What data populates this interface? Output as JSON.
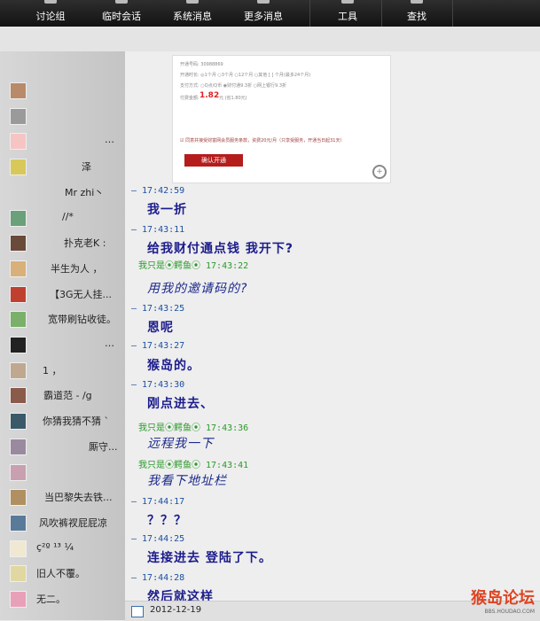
{
  "toolbar": {
    "items": [
      "讨论组",
      "临时会话",
      "系统消息",
      "更多消息",
      "工具",
      "查找"
    ]
  },
  "sidebar": {
    "items": [
      {
        "name": "",
        "av": "#b88a6a"
      },
      {
        "name": "",
        "av": "#9a9a9a"
      },
      {
        "name": "…",
        "av": "#f7c4c4"
      },
      {
        "name": "泽",
        "av": "#d8c85a"
      },
      {
        "name": "Mr  zhi丶",
        "av": ""
      },
      {
        "name": "//*",
        "av": "#6aa07a"
      },
      {
        "name": "扑克老K :",
        "av": "#6a4a3a"
      },
      {
        "name": "半生为人   ，",
        "av": "#d8b07a"
      },
      {
        "name": "【3G无人挂...",
        "av": "#c04030"
      },
      {
        "name": "宽带刷钻收徒。",
        "av": "#7ab06a"
      },
      {
        "name": "…",
        "av": "#222222"
      },
      {
        "name": "1 ，",
        "av": "#c0a890"
      },
      {
        "name": "霸道范 - /g",
        "av": "#8a5a4a"
      },
      {
        "name": "你猜我猜不猜 `",
        "av": "#3a5a6a"
      },
      {
        "name": "厮守...",
        "av": "#9a8aa0"
      },
      {
        "name": "",
        "av": "#c8a0b0"
      },
      {
        "name": "当巴黎失去铁...",
        "av": "#b09060"
      },
      {
        "name": "风吹裤衩屁屁凉",
        "av": "#5a7a9a"
      },
      {
        "name": "ç²º ¹³ ¼",
        "av": "#f0e8d0"
      },
      {
        "name": "旧人不覆。",
        "av": "#e0d8a0"
      },
      {
        "name": "无二。",
        "av": "#e8a0b8"
      }
    ]
  },
  "pay_image": {
    "rows": [
      "开通号码:  30988869",
      "开通时长: ◎1个月  ○3个月  ○12个月  ○其他 [    ] 个月(最多24个月)",
      "支付方式:  ○Q点/Q币   ◉财付通9.3折   ○网上银行9.3折",
      "付费金额:"
    ],
    "amount": "1.82",
    "amount_suffix": "元 (省1.80元)",
    "agree": "☑ 同意并接受财富网会员服务条款，资费20元/月（只享受服务，开通当日起31天）",
    "button": "确认开通"
  },
  "messages": [
    {
      "kind": "ts",
      "text": "— 17:42:59"
    },
    {
      "kind": "msg",
      "text": "我一折"
    },
    {
      "kind": "ts",
      "text": "— 17:43:11"
    },
    {
      "kind": "msg",
      "text": "给我财付通点钱 我开下?"
    },
    {
      "kind": "tsg",
      "text": "我只是⦿鳄鱼⦿  17:43:22"
    },
    {
      "kind": "msgi",
      "text": "用我的邀请码的?"
    },
    {
      "kind": "ts",
      "text": "— 17:43:25"
    },
    {
      "kind": "msg",
      "text": "恩呢"
    },
    {
      "kind": "ts",
      "text": "— 17:43:27"
    },
    {
      "kind": "msg",
      "text": "猴岛的。"
    },
    {
      "kind": "ts",
      "text": "— 17:43:30"
    },
    {
      "kind": "msg",
      "text": "刚点进去、"
    },
    {
      "kind": "tsg",
      "text": "我只是⦿鳄鱼⦿  17:43:36"
    },
    {
      "kind": "msgi",
      "text": "远程我一下"
    },
    {
      "kind": "tsg",
      "text": "我只是⦿鳄鱼⦿  17:43:41"
    },
    {
      "kind": "msgi",
      "text": "我看下地址栏"
    },
    {
      "kind": "ts",
      "text": "— 17:44:17"
    },
    {
      "kind": "msg",
      "text": "？？？"
    },
    {
      "kind": "ts",
      "text": "— 17:44:25"
    },
    {
      "kind": "msg",
      "text": "连接进去 登陆了下。"
    },
    {
      "kind": "ts",
      "text": "— 17:44:28"
    },
    {
      "kind": "msg",
      "text": "然后就这样"
    }
  ],
  "bottom": {
    "date": "2012-12-19"
  },
  "watermark": {
    "big": "猴岛论坛",
    "small": "BBS.HOUDAO.COM"
  }
}
